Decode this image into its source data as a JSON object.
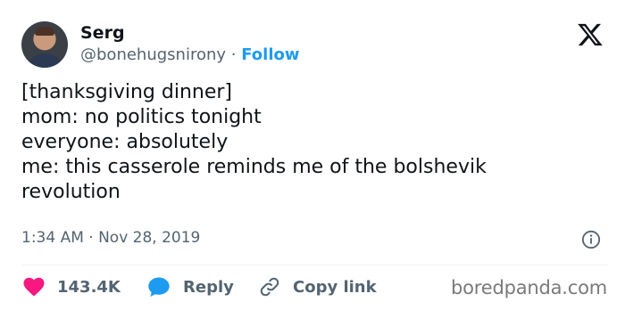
{
  "user": {
    "name": "Serg",
    "handle": "@bonehugsnirony",
    "separator": "·",
    "follow_label": "Follow"
  },
  "tweet": {
    "lines": [
      "[thanksgiving dinner]",
      "mom: no politics tonight",
      "everyone: absolutely",
      "me: this casserole reminds me of the bolshevik",
      "revolution"
    ],
    "timestamp": "1:34 AM · Nov 28, 2019"
  },
  "actions": {
    "likes": "143.4K",
    "reply_label": "Reply",
    "copy_label": "Copy link"
  },
  "icons": {
    "x_logo": "x-logo-icon",
    "info": "info-icon",
    "heart": "heart-icon",
    "reply": "reply-bubble-icon",
    "link": "link-icon"
  },
  "colors": {
    "accent": "#1d9bf0",
    "like": "#f91880",
    "muted": "#536471",
    "text": "#0f1419"
  },
  "watermark": "boredpanda.com"
}
